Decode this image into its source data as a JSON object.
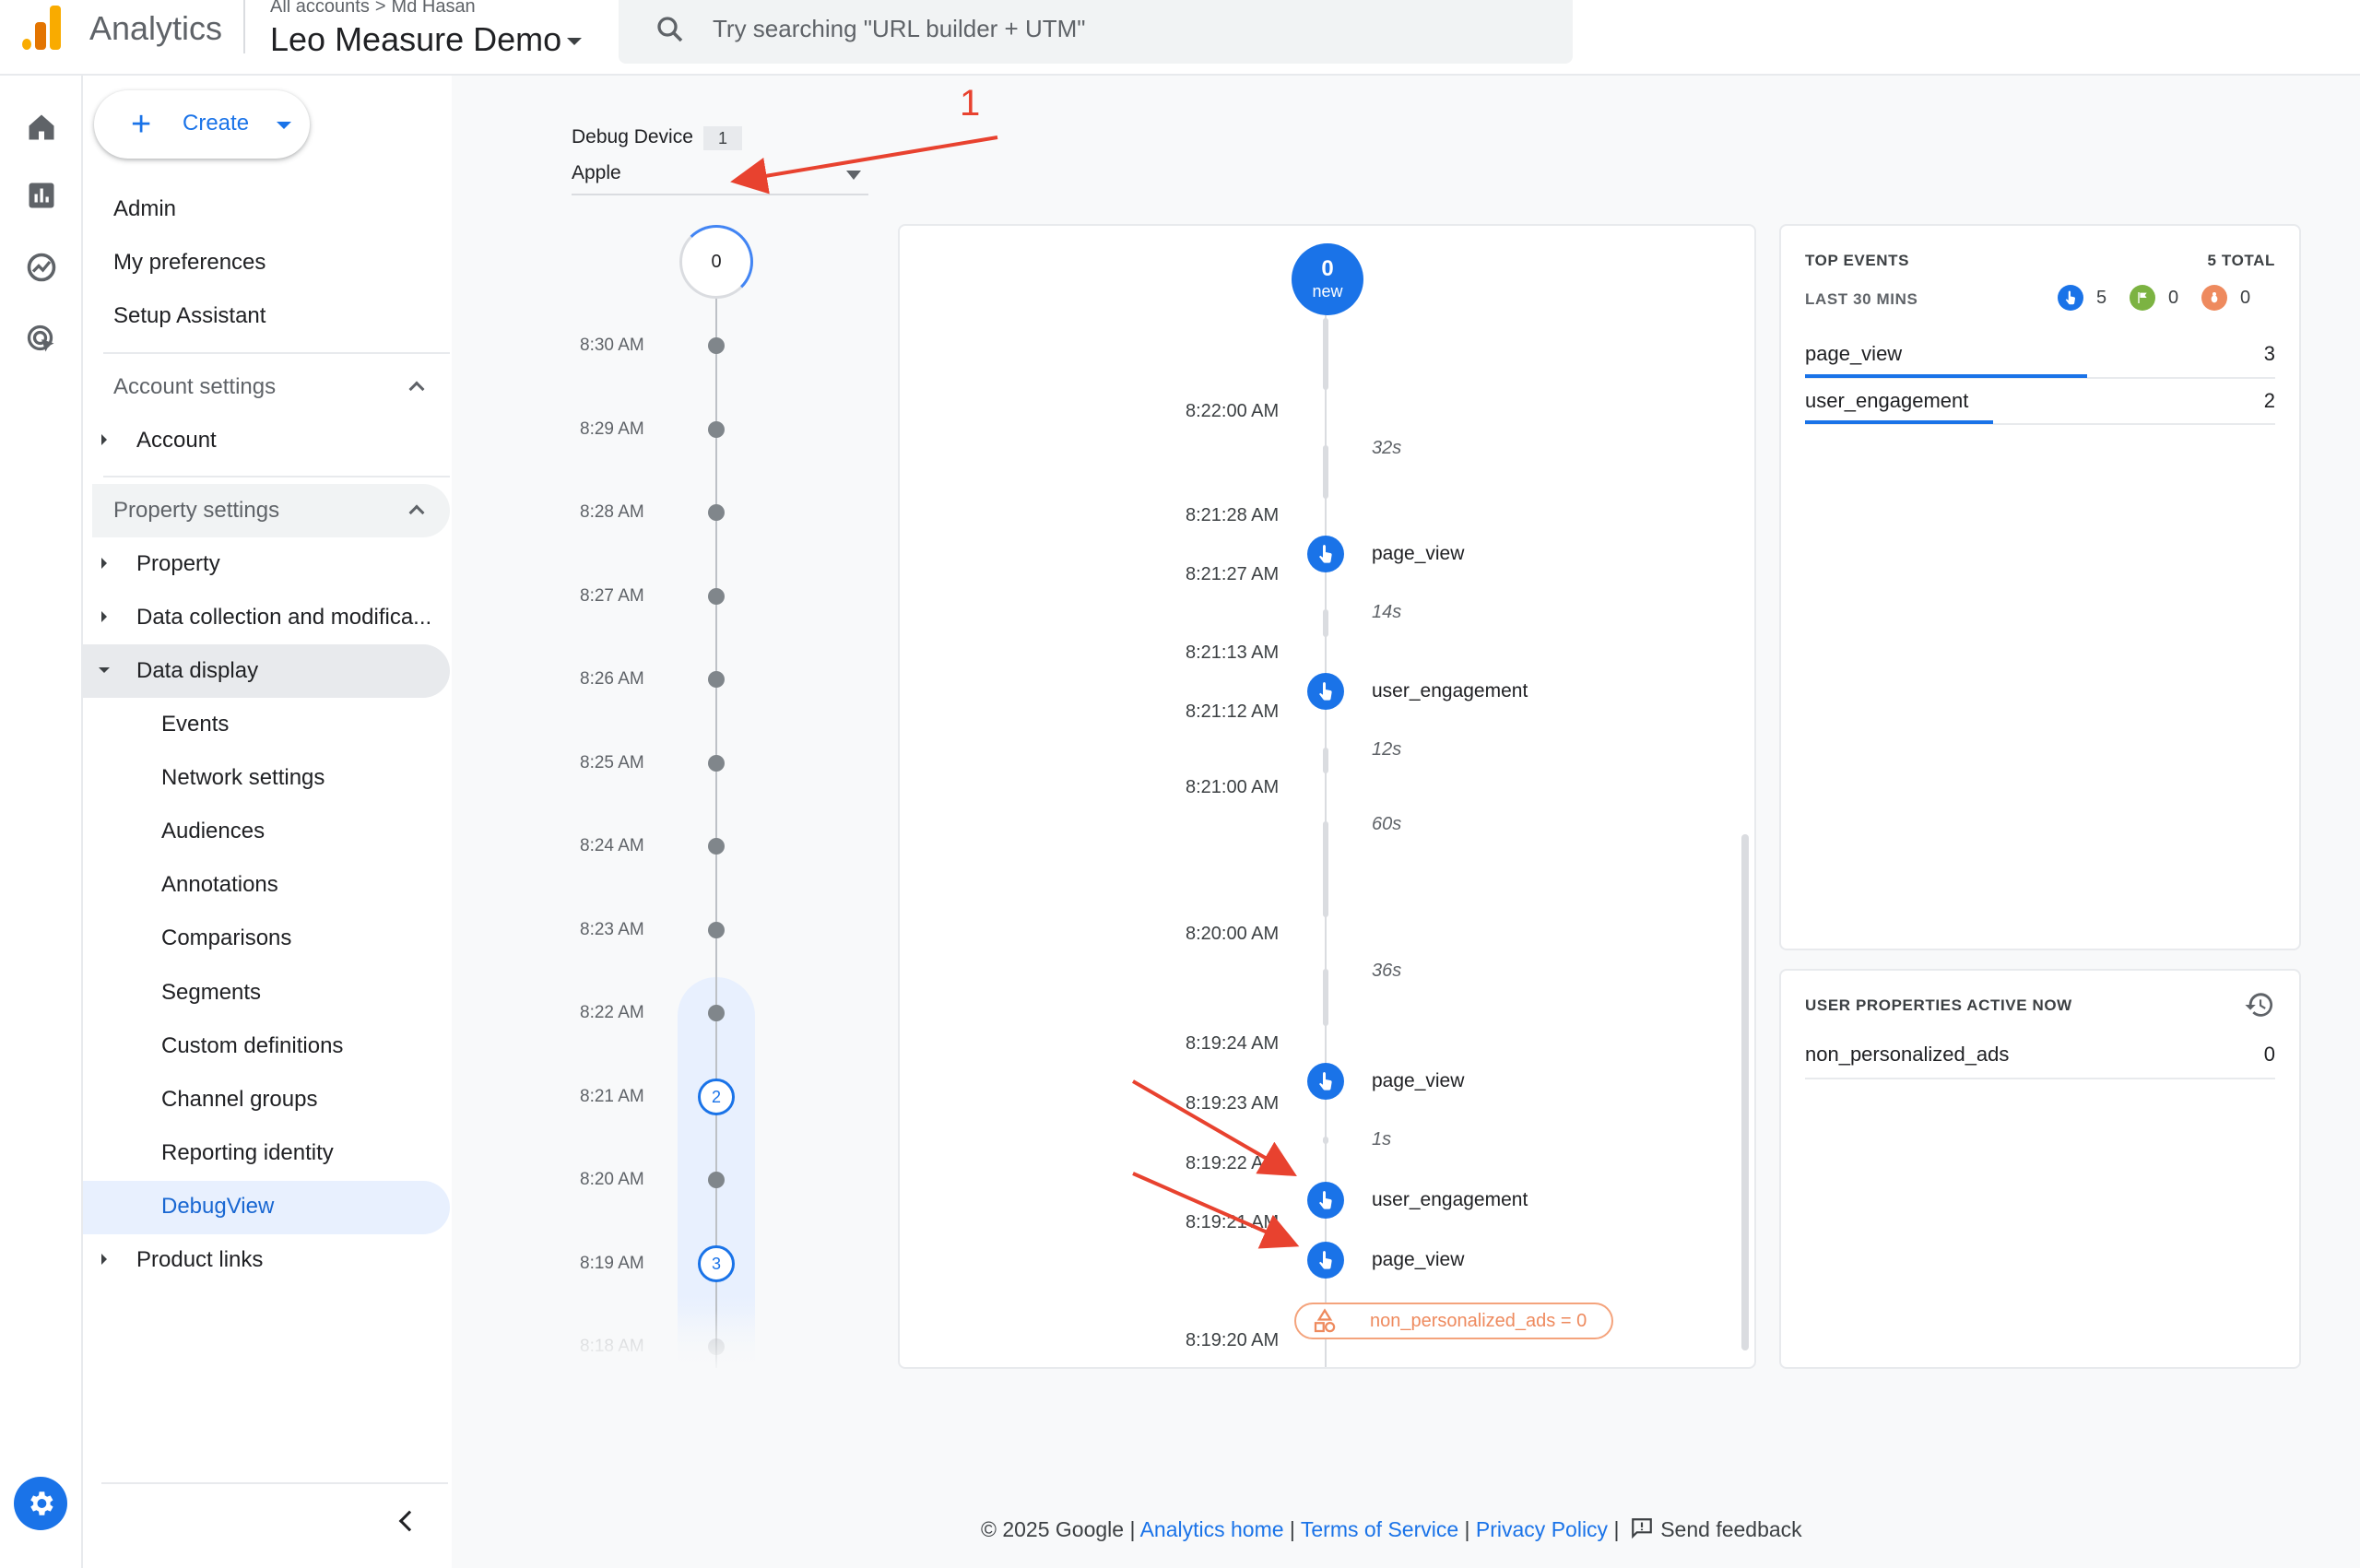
{
  "header": {
    "app_name": "Analytics",
    "breadcrumb_root": "All accounts",
    "breadcrumb_account": "Md Hasan",
    "property_name": "Leo Measure Demo",
    "search_placeholder": "Try searching \"URL builder + UTM\""
  },
  "rail": {
    "icons": [
      "home-icon",
      "reports-icon",
      "explore-icon",
      "advertising-icon"
    ],
    "settings_icon": "gear-icon"
  },
  "sidenav": {
    "create_label": "Create",
    "admin": "Admin",
    "my_preferences": "My preferences",
    "setup_assistant": "Setup Assistant",
    "account_settings": "Account settings",
    "account": "Account",
    "property_settings": "Property settings",
    "property": "Property",
    "data_collection": "Data collection and modifica...",
    "data_display": "Data display",
    "sub_items": [
      "Events",
      "Network settings",
      "Audiences",
      "Annotations",
      "Comparisons",
      "Segments",
      "Custom definitions",
      "Channel groups",
      "Reporting identity",
      "DebugView"
    ],
    "product_links": "Product links",
    "active_color": "#e8f0fe"
  },
  "debug": {
    "device_label": "Debug Device",
    "device_count": "1",
    "device_value": "Apple"
  },
  "minutes": {
    "ring_value": "0",
    "rows": [
      {
        "time": "8:30 AM",
        "count": ""
      },
      {
        "time": "8:29 AM",
        "count": ""
      },
      {
        "time": "8:28 AM",
        "count": ""
      },
      {
        "time": "8:27 AM",
        "count": ""
      },
      {
        "time": "8:26 AM",
        "count": ""
      },
      {
        "time": "8:25 AM",
        "count": ""
      },
      {
        "time": "8:24 AM",
        "count": ""
      },
      {
        "time": "8:23 AM",
        "count": ""
      },
      {
        "time": "8:22 AM",
        "count": ""
      },
      {
        "time": "8:21 AM",
        "count": "2"
      },
      {
        "time": "8:20 AM",
        "count": ""
      },
      {
        "time": "8:19 AM",
        "count": "3"
      },
      {
        "time": "8:18 AM",
        "count": ""
      }
    ]
  },
  "stream": {
    "new_count": "0",
    "new_label": "new",
    "timestamps": [
      "8:22:00 AM",
      "8:21:28 AM",
      "8:21:27 AM",
      "8:21:13 AM",
      "8:21:12 AM",
      "8:21:00 AM",
      "8:20:00 AM",
      "8:19:24 AM",
      "8:19:23 AM",
      "8:19:22 AM",
      "8:19:21 AM",
      "8:19:20 AM"
    ],
    "durations": [
      "32s",
      "14s",
      "12s",
      "60s",
      "36s",
      "1s"
    ],
    "events": [
      "page_view",
      "user_engagement",
      "page_view",
      "user_engagement",
      "page_view"
    ],
    "user_property": "non_personalized_ads = 0"
  },
  "top_events": {
    "title": "TOP EVENTS",
    "total": "5 TOTAL",
    "window": "LAST 30 MINS",
    "counts": {
      "events": "5",
      "conversions": "0",
      "errors": "0"
    },
    "rows": [
      {
        "name": "page_view",
        "value": "3",
        "share": 0.6
      },
      {
        "name": "user_engagement",
        "value": "2",
        "share": 0.4
      }
    ]
  },
  "user_props": {
    "title": "USER PROPERTIES ACTIVE NOW",
    "rows": [
      {
        "name": "non_personalized_ads",
        "value": "0"
      }
    ]
  },
  "annotation": {
    "label": "1",
    "color": "#e8422f"
  },
  "footer": {
    "copyright": "© 2025 Google",
    "analytics_home": "Analytics home",
    "terms": "Terms of Service",
    "privacy": "Privacy Policy",
    "feedback": "Send feedback"
  }
}
